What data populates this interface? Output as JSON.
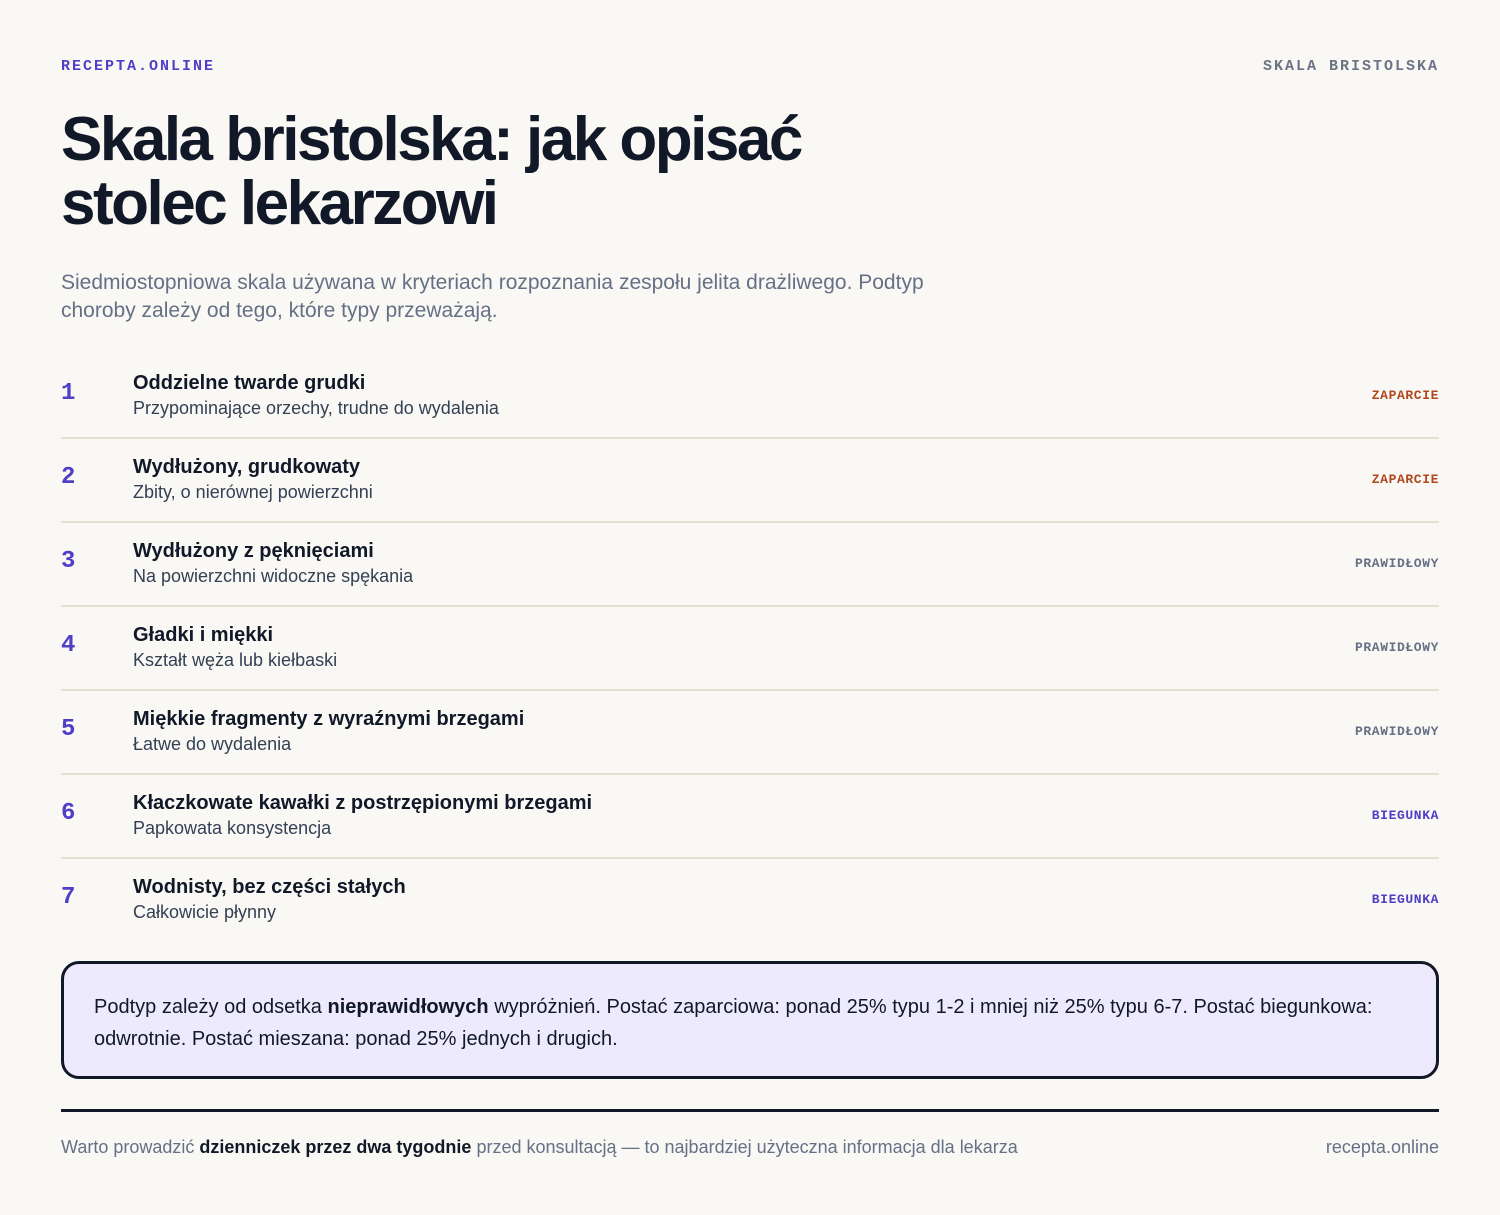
{
  "header": {
    "brand": "RECEPTA.ONLINE",
    "section": "SKALA BRISTOLSKA"
  },
  "title": "Skala bristolska: jak opisać stolec lekarzowi",
  "subtitle": "Siedmiostopniowa skala używana w kryteriach rozpoznania zespołu jelita drażliwego. Podtyp choroby zależy od tego, które typy przeważają.",
  "types": [
    {
      "number": "1",
      "title": "Oddzielne twarde grudki",
      "description": "Przypominające orzechy, trudne do wydalenia",
      "category": "ZAPARCIE"
    },
    {
      "number": "2",
      "title": "Wydłużony, grudkowaty",
      "description": "Zbity, o nierównej powierzchni",
      "category": "ZAPARCIE"
    },
    {
      "number": "3",
      "title": "Wydłużony z pęknięciami",
      "description": "Na powierzchni widoczne spękania",
      "category": "PRAWIDŁOWY"
    },
    {
      "number": "4",
      "title": "Gładki i miękki",
      "description": "Kształt węża lub kiełbaski",
      "category": "PRAWIDŁOWY"
    },
    {
      "number": "5",
      "title": "Miękkie fragmenty z wyraźnymi brzegami",
      "description": "Łatwe do wydalenia",
      "category": "PRAWIDŁOWY"
    },
    {
      "number": "6",
      "title": "Kłaczkowate kawałki z postrzępionymi brzegami",
      "description": "Papkowata konsystencja",
      "category": "BIEGUNKA"
    },
    {
      "number": "7",
      "title": "Wodnisty, bez części stałych",
      "description": "Całkowicie płynny",
      "category": "BIEGUNKA"
    }
  ],
  "callout": {
    "before": "Podtyp zależy od odsetka ",
    "bold": "nieprawidłowych",
    "after": " wypróżnień. Postać zaparciowa: ponad 25% typu 1-2 i mniej niż 25% typu 6-7. Postać biegunkowa: odwrotnie. Postać mieszana: ponad 25% jednych i drugich."
  },
  "footer": {
    "before": "Warto prowadzić ",
    "bold": "dzienniczek przez dwa tygodnie",
    "after": " przed konsultacją — to najbardziej użyteczna informacja dla lekarza",
    "site": "recepta.online"
  },
  "colors": {
    "accent": "#4f3fc7",
    "zaparcie": "#b0471d",
    "prawidlowy": "#667085",
    "biegunka": "#4f3fc7",
    "callout_background": "#edeafd"
  }
}
